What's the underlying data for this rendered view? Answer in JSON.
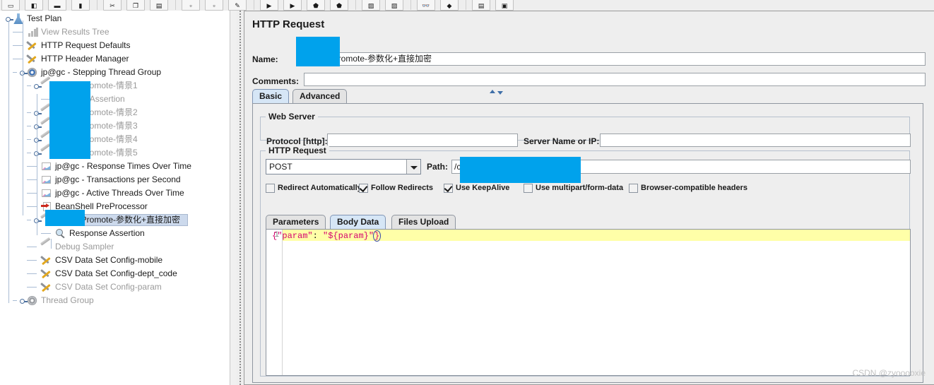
{
  "toolbar": {
    "buttons": [
      {
        "name": "new-icon",
        "glyph": "▭"
      },
      {
        "name": "templates-icon",
        "glyph": "◧"
      },
      {
        "name": "open-icon",
        "glyph": "▬"
      },
      {
        "name": "save-icon",
        "glyph": "▮"
      },
      {
        "name": "cut-icon",
        "glyph": "✂"
      },
      {
        "name": "copy-icon",
        "glyph": "❐"
      },
      {
        "name": "paste-icon",
        "glyph": "▤"
      },
      {
        "name": "expand-icon",
        "glyph": "▫"
      },
      {
        "name": "collapse-icon",
        "glyph": "▫"
      },
      {
        "name": "toggle-icon",
        "glyph": "✎"
      },
      {
        "name": "start-icon",
        "glyph": "▶"
      },
      {
        "name": "start-no-pauses-icon",
        "glyph": "▶"
      },
      {
        "name": "stop-icon",
        "glyph": "⬟"
      },
      {
        "name": "shutdown-icon",
        "glyph": "⬟"
      },
      {
        "name": "clear-icon",
        "glyph": "▨"
      },
      {
        "name": "clear-all-icon",
        "glyph": "▨"
      },
      {
        "name": "search-icon",
        "glyph": "👓"
      },
      {
        "name": "reset-search-icon",
        "glyph": "◆"
      },
      {
        "name": "function-helper-icon",
        "glyph": "▤"
      },
      {
        "name": "help-icon",
        "glyph": "▣"
      }
    ]
  },
  "tree": {
    "nodes": [
      {
        "label": "Test Plan",
        "icon": "flask",
        "depth": 0,
        "knob": true,
        "dim": false,
        "selected": false
      },
      {
        "label": "View Results Tree",
        "icon": "chart",
        "depth": 1,
        "knob": false,
        "dim": true,
        "selected": false
      },
      {
        "label": "HTTP Request Defaults",
        "icon": "tools",
        "depth": 1,
        "knob": false,
        "dim": false,
        "selected": false
      },
      {
        "label": "HTTP Header Manager",
        "icon": "tools",
        "depth": 1,
        "knob": false,
        "dim": false,
        "selected": false
      },
      {
        "label": "jp@gc - Stepping Thread Group",
        "icon": "gear",
        "depth": 1,
        "knob": true,
        "dim": false,
        "selected": false
      },
      {
        "label": "DevicePromote-情景1",
        "icon": "pencil",
        "depth": 2,
        "knob": true,
        "dim": true,
        "selected": false
      },
      {
        "label": "onse Assertion",
        "icon": "none",
        "depth": 3,
        "knob": false,
        "dim": true,
        "selected": false
      },
      {
        "label": "DevicePromote-情景2",
        "icon": "pencil",
        "depth": 2,
        "knob": true,
        "dim": true,
        "selected": false
      },
      {
        "label": "DevicePromote-情景3",
        "icon": "pencil",
        "depth": 2,
        "knob": true,
        "dim": true,
        "selected": false
      },
      {
        "label": "DevicePromote-情景4",
        "icon": "pencil",
        "depth": 2,
        "knob": true,
        "dim": true,
        "selected": false
      },
      {
        "label": "DevicePromote-情景5",
        "icon": "pencil",
        "depth": 2,
        "knob": true,
        "dim": true,
        "selected": false
      },
      {
        "label": "jp@gc - Response Times Over Time",
        "icon": "jpchart",
        "depth": 2,
        "knob": false,
        "dim": false,
        "selected": false
      },
      {
        "label": "jp@gc - Transactions per Second",
        "icon": "jpchart",
        "depth": 2,
        "knob": false,
        "dim": false,
        "selected": false
      },
      {
        "label": "jp@gc - Active Threads Over Time",
        "icon": "jpchart",
        "depth": 2,
        "knob": false,
        "dim": false,
        "selected": false
      },
      {
        "label": "BeanShell PreProcessor",
        "icon": "pre",
        "depth": 2,
        "knob": false,
        "dim": false,
        "selected": false
      },
      {
        "label": "DevicePromote-参数化+直接加密",
        "icon": "pencil",
        "depth": 2,
        "knob": true,
        "dim": false,
        "selected": true
      },
      {
        "label": "Response Assertion",
        "icon": "mag",
        "depth": 3,
        "knob": false,
        "dim": false,
        "selected": false
      },
      {
        "label": "Debug Sampler",
        "icon": "pencil",
        "depth": 2,
        "knob": false,
        "dim": true,
        "selected": false
      },
      {
        "label": "CSV Data Set Config-mobile",
        "icon": "tools",
        "depth": 2,
        "knob": false,
        "dim": false,
        "selected": false
      },
      {
        "label": "CSV Data Set Config-dept_code",
        "icon": "tools",
        "depth": 2,
        "knob": false,
        "dim": false,
        "selected": false
      },
      {
        "label": "CSV Data Set Config-param",
        "icon": "tools",
        "depth": 2,
        "knob": false,
        "dim": true,
        "selected": false
      },
      {
        "label": "Thread Group",
        "icon": "gear",
        "depth": 1,
        "knob": true,
        "dim": true,
        "selected": false
      }
    ]
  },
  "panel": {
    "title": "HTTP Request",
    "name_label": "Name:",
    "name_value": "DevicePromote-参数化+直接加密",
    "comments_label": "Comments:",
    "comments_value": "",
    "tabs": [
      {
        "label": "Basic",
        "active": true
      },
      {
        "label": "Advanced",
        "active": false
      }
    ],
    "web_server": {
      "group_title": "Web Server",
      "protocol_label": "Protocol [http]:",
      "protocol_value": "",
      "server_label": "Server Name or IP:",
      "server_value": ""
    },
    "http_request": {
      "group_title": "HTTP Request",
      "method_value": "POST",
      "path_label": "Path:",
      "path_value": "/cen                                 dDevicePromote",
      "checkboxes": [
        {
          "label": "Redirect Automatically",
          "checked": false
        },
        {
          "label": "Follow Redirects",
          "checked": true
        },
        {
          "label": "Use KeepAlive",
          "checked": true
        },
        {
          "label": "Use multipart/form-data",
          "checked": false
        },
        {
          "label": "Browser-compatible headers",
          "checked": false
        }
      ],
      "inner_tabs": [
        {
          "label": "Parameters",
          "active": false
        },
        {
          "label": "Body Data",
          "active": true
        },
        {
          "label": "Files Upload",
          "active": false
        }
      ],
      "editor": {
        "line_number": "1",
        "code_parts": [
          {
            "text": "{",
            "cls": "c-brace"
          },
          {
            "text": "\"param\"",
            "cls": "c-str"
          },
          {
            "text": ": ",
            "cls": "c-punc"
          },
          {
            "text": "\"${param}\"",
            "cls": "c-str"
          },
          {
            "text": "}",
            "cls": "c-brace-caret"
          }
        ]
      }
    }
  },
  "watermark": "CSDN @zyooooxie",
  "colors": {
    "redaction": "#00a2ec",
    "selection": "#ccd9ec",
    "tab_active": "#d6e6f6",
    "editor_line": "#ffffa8",
    "panel_bg": "#eeeeee"
  }
}
